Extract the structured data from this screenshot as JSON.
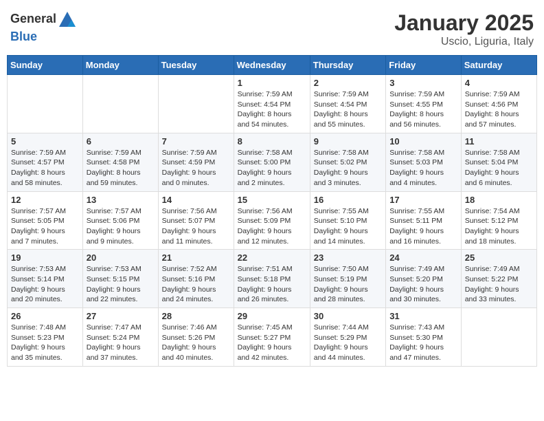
{
  "header": {
    "logo_general": "General",
    "logo_blue": "Blue",
    "month": "January 2025",
    "location": "Uscio, Liguria, Italy"
  },
  "weekdays": [
    "Sunday",
    "Monday",
    "Tuesday",
    "Wednesday",
    "Thursday",
    "Friday",
    "Saturday"
  ],
  "weeks": [
    [
      {
        "day": "",
        "info": ""
      },
      {
        "day": "",
        "info": ""
      },
      {
        "day": "",
        "info": ""
      },
      {
        "day": "1",
        "info": "Sunrise: 7:59 AM\nSunset: 4:54 PM\nDaylight: 8 hours\nand 54 minutes."
      },
      {
        "day": "2",
        "info": "Sunrise: 7:59 AM\nSunset: 4:54 PM\nDaylight: 8 hours\nand 55 minutes."
      },
      {
        "day": "3",
        "info": "Sunrise: 7:59 AM\nSunset: 4:55 PM\nDaylight: 8 hours\nand 56 minutes."
      },
      {
        "day": "4",
        "info": "Sunrise: 7:59 AM\nSunset: 4:56 PM\nDaylight: 8 hours\nand 57 minutes."
      }
    ],
    [
      {
        "day": "5",
        "info": "Sunrise: 7:59 AM\nSunset: 4:57 PM\nDaylight: 8 hours\nand 58 minutes."
      },
      {
        "day": "6",
        "info": "Sunrise: 7:59 AM\nSunset: 4:58 PM\nDaylight: 8 hours\nand 59 minutes."
      },
      {
        "day": "7",
        "info": "Sunrise: 7:59 AM\nSunset: 4:59 PM\nDaylight: 9 hours\nand 0 minutes."
      },
      {
        "day": "8",
        "info": "Sunrise: 7:58 AM\nSunset: 5:00 PM\nDaylight: 9 hours\nand 2 minutes."
      },
      {
        "day": "9",
        "info": "Sunrise: 7:58 AM\nSunset: 5:02 PM\nDaylight: 9 hours\nand 3 minutes."
      },
      {
        "day": "10",
        "info": "Sunrise: 7:58 AM\nSunset: 5:03 PM\nDaylight: 9 hours\nand 4 minutes."
      },
      {
        "day": "11",
        "info": "Sunrise: 7:58 AM\nSunset: 5:04 PM\nDaylight: 9 hours\nand 6 minutes."
      }
    ],
    [
      {
        "day": "12",
        "info": "Sunrise: 7:57 AM\nSunset: 5:05 PM\nDaylight: 9 hours\nand 7 minutes."
      },
      {
        "day": "13",
        "info": "Sunrise: 7:57 AM\nSunset: 5:06 PM\nDaylight: 9 hours\nand 9 minutes."
      },
      {
        "day": "14",
        "info": "Sunrise: 7:56 AM\nSunset: 5:07 PM\nDaylight: 9 hours\nand 11 minutes."
      },
      {
        "day": "15",
        "info": "Sunrise: 7:56 AM\nSunset: 5:09 PM\nDaylight: 9 hours\nand 12 minutes."
      },
      {
        "day": "16",
        "info": "Sunrise: 7:55 AM\nSunset: 5:10 PM\nDaylight: 9 hours\nand 14 minutes."
      },
      {
        "day": "17",
        "info": "Sunrise: 7:55 AM\nSunset: 5:11 PM\nDaylight: 9 hours\nand 16 minutes."
      },
      {
        "day": "18",
        "info": "Sunrise: 7:54 AM\nSunset: 5:12 PM\nDaylight: 9 hours\nand 18 minutes."
      }
    ],
    [
      {
        "day": "19",
        "info": "Sunrise: 7:53 AM\nSunset: 5:14 PM\nDaylight: 9 hours\nand 20 minutes."
      },
      {
        "day": "20",
        "info": "Sunrise: 7:53 AM\nSunset: 5:15 PM\nDaylight: 9 hours\nand 22 minutes."
      },
      {
        "day": "21",
        "info": "Sunrise: 7:52 AM\nSunset: 5:16 PM\nDaylight: 9 hours\nand 24 minutes."
      },
      {
        "day": "22",
        "info": "Sunrise: 7:51 AM\nSunset: 5:18 PM\nDaylight: 9 hours\nand 26 minutes."
      },
      {
        "day": "23",
        "info": "Sunrise: 7:50 AM\nSunset: 5:19 PM\nDaylight: 9 hours\nand 28 minutes."
      },
      {
        "day": "24",
        "info": "Sunrise: 7:49 AM\nSunset: 5:20 PM\nDaylight: 9 hours\nand 30 minutes."
      },
      {
        "day": "25",
        "info": "Sunrise: 7:49 AM\nSunset: 5:22 PM\nDaylight: 9 hours\nand 33 minutes."
      }
    ],
    [
      {
        "day": "26",
        "info": "Sunrise: 7:48 AM\nSunset: 5:23 PM\nDaylight: 9 hours\nand 35 minutes."
      },
      {
        "day": "27",
        "info": "Sunrise: 7:47 AM\nSunset: 5:24 PM\nDaylight: 9 hours\nand 37 minutes."
      },
      {
        "day": "28",
        "info": "Sunrise: 7:46 AM\nSunset: 5:26 PM\nDaylight: 9 hours\nand 40 minutes."
      },
      {
        "day": "29",
        "info": "Sunrise: 7:45 AM\nSunset: 5:27 PM\nDaylight: 9 hours\nand 42 minutes."
      },
      {
        "day": "30",
        "info": "Sunrise: 7:44 AM\nSunset: 5:29 PM\nDaylight: 9 hours\nand 44 minutes."
      },
      {
        "day": "31",
        "info": "Sunrise: 7:43 AM\nSunset: 5:30 PM\nDaylight: 9 hours\nand 47 minutes."
      },
      {
        "day": "",
        "info": ""
      }
    ]
  ]
}
